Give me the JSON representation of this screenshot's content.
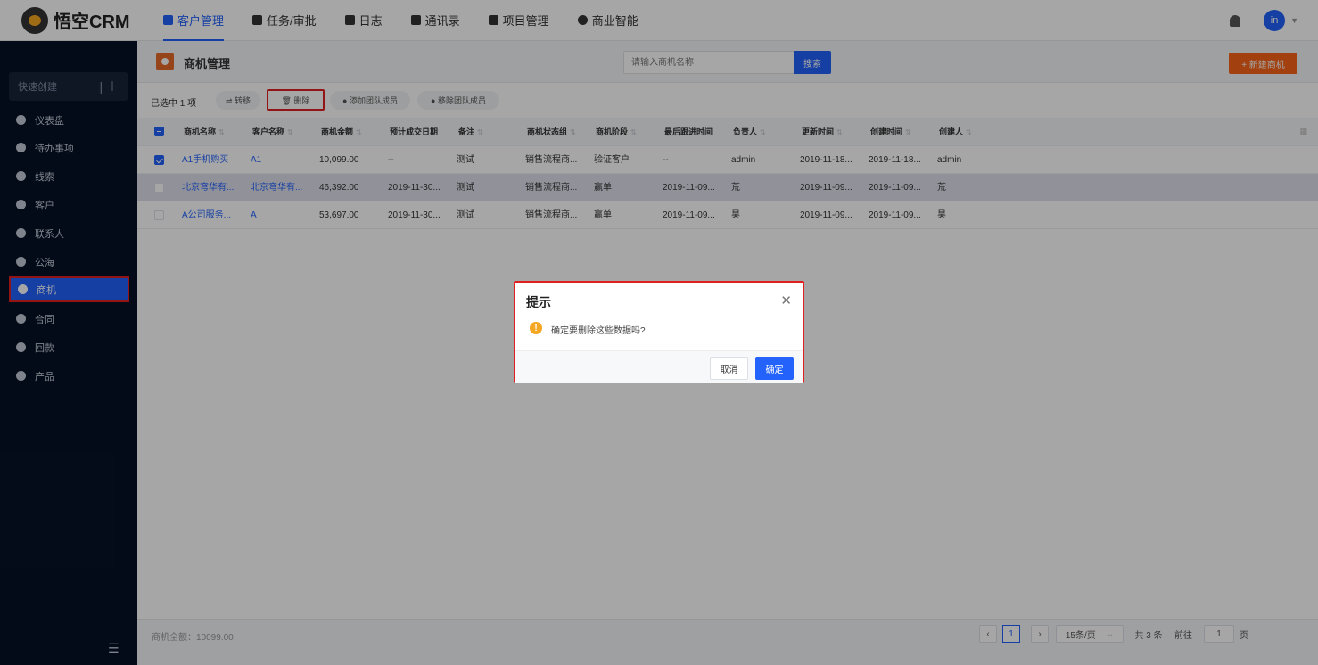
{
  "app": {
    "title": "悟空CRM"
  },
  "topnav": {
    "items": [
      {
        "label": "客户管理",
        "icon": "building-icon"
      },
      {
        "label": "任务/审批",
        "icon": "briefcase-icon"
      },
      {
        "label": "日志",
        "icon": "log-icon"
      },
      {
        "label": "通讯录",
        "icon": "contacts-icon"
      },
      {
        "label": "项目管理",
        "icon": "project-icon"
      },
      {
        "label": "商业智能",
        "icon": "bi-icon"
      }
    ],
    "active_index": 0,
    "avatar_text": "in",
    "accent_color": "#2362fb"
  },
  "sidebar": {
    "quick_create": "快速创建",
    "items": [
      {
        "label": "仪表盘",
        "icon": "dashboard-icon"
      },
      {
        "label": "待办事项",
        "icon": "todo-icon"
      },
      {
        "label": "线索",
        "icon": "leads-icon"
      },
      {
        "label": "客户",
        "icon": "customer-icon"
      },
      {
        "label": "联系人",
        "icon": "contact-icon"
      },
      {
        "label": "公海",
        "icon": "pool-icon"
      },
      {
        "label": "商机",
        "icon": "opportunity-icon"
      },
      {
        "label": "合同",
        "icon": "contract-icon"
      },
      {
        "label": "回款",
        "icon": "payment-icon"
      },
      {
        "label": "产品",
        "icon": "product-icon"
      }
    ],
    "active_index": 6
  },
  "page": {
    "title": "商机管理",
    "search_placeholder": "请输入商机名称",
    "search_button": "搜索",
    "new_button": "+ 新建商机"
  },
  "toolbar": {
    "selected_text": "已选中 1 项",
    "transfer": "⇌ 转移",
    "delete": "🗑 删除",
    "add_member": "● 添加团队成员",
    "remove_member": "● 移除团队成员"
  },
  "table": {
    "columns": [
      "商机名称",
      "客户名称",
      "商机金额",
      "预计成交日期",
      "备注",
      "商机状态组",
      "商机阶段",
      "最后跟进时间",
      "负责人",
      "更新时间",
      "创建时间",
      "创建人"
    ],
    "rows": [
      {
        "checked": true,
        "cells": [
          "A1手机购买",
          "A1",
          "10,099.00",
          "--",
          "测试",
          "销售流程商...",
          "验证客户",
          "--",
          "admin",
          "2019-11-18...",
          "2019-11-18...",
          "admin"
        ]
      },
      {
        "checked": false,
        "cells": [
          "北京穹华有...",
          "北京穹华有...",
          "46,392.00",
          "2019-11-30...",
          "测试",
          "销售流程商...",
          "赢单",
          "2019-11-09...",
          "荒",
          "2019-11-09...",
          "2019-11-09...",
          "荒"
        ]
      },
      {
        "checked": false,
        "cells": [
          "A公司服务...",
          "A",
          "53,697.00",
          "2019-11-30...",
          "测试",
          "销售流程商...",
          "赢单",
          "2019-11-09...",
          "昊",
          "2019-11-09...",
          "2019-11-09...",
          "昊"
        ]
      }
    ]
  },
  "footer": {
    "sum": "商机全额：10099.00",
    "current_page": "1",
    "page_size": "15条/页",
    "total": "共 3 条",
    "goto_label": "前往",
    "goto_value": "1",
    "page_unit": "页"
  },
  "dialog": {
    "title": "提示",
    "message": "确定要删除这些数据吗?",
    "cancel": "取消",
    "confirm": "确定"
  }
}
